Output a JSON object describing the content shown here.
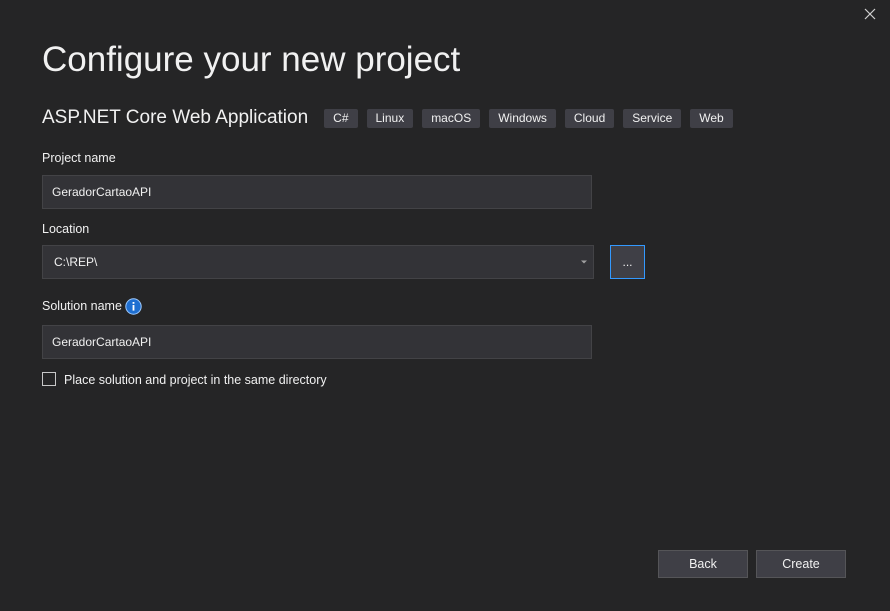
{
  "window": {
    "close_icon": "close-icon"
  },
  "header": {
    "title": "Configure your new project"
  },
  "template": {
    "name": "ASP.NET Core Web Application",
    "tags": [
      "C#",
      "Linux",
      "macOS",
      "Windows",
      "Cloud",
      "Service",
      "Web"
    ]
  },
  "project_name": {
    "label": "Project name",
    "value": "GeradorCartaoAPI"
  },
  "location": {
    "label": "Location",
    "value": "C:\\REP\\",
    "browse_label": "..."
  },
  "solution_name": {
    "label": "Solution name",
    "value": "GeradorCartaoAPI",
    "info_icon": "info-icon"
  },
  "same_directory": {
    "label": "Place solution and project in the same directory",
    "checked": false
  },
  "footer": {
    "back_label": "Back",
    "create_label": "Create"
  },
  "colors": {
    "background": "#252526",
    "input_background": "#333337",
    "button_background": "#3f3f46",
    "accent": "#3399ff",
    "text": "#f1f1f1"
  }
}
